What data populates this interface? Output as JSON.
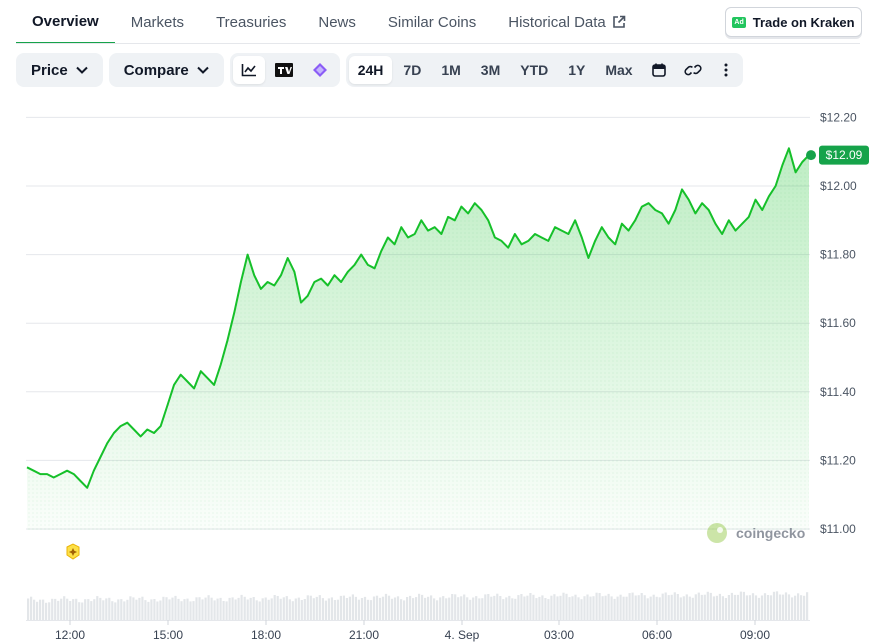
{
  "tabs": [
    {
      "label": "Overview",
      "active": true
    },
    {
      "label": "Markets"
    },
    {
      "label": "Treasuries"
    },
    {
      "label": "News"
    },
    {
      "label": "Similar Coins"
    },
    {
      "label": "Historical Data"
    }
  ],
  "trade_button": {
    "ad": "Ad",
    "label": "Trade on Kraken"
  },
  "toolbar": {
    "price": "Price",
    "compare": "Compare",
    "ranges": [
      "24H",
      "7D",
      "1M",
      "3M",
      "YTD",
      "1Y",
      "Max"
    ],
    "active_range": "24H"
  },
  "icons": [
    "line-chart-icon",
    "tradingview-icon",
    "diamond-icon",
    "calendar-icon",
    "link-icon",
    "more-icon",
    "chevron-down-icon",
    "external-link-icon"
  ],
  "colors": {
    "line": "#16c02a",
    "accent": "#16a34a",
    "label_bg": "#16a34a",
    "badge": "#fde047"
  },
  "watermark": "coingecko",
  "chart_data": {
    "type": "area",
    "ylim": [
      10.95,
      12.22
    ],
    "yticks": [
      11.0,
      11.2,
      11.4,
      11.6,
      11.8,
      12.0,
      12.2
    ],
    "ytick_labels": [
      "$11.00",
      "$11.20",
      "$11.40",
      "$11.60",
      "$11.80",
      "$12.00",
      "$12.20"
    ],
    "xtick_labels": [
      "12:00",
      "15:00",
      "18:00",
      "21:00",
      "4. Sep",
      "03:00",
      "06:00",
      "09:00"
    ],
    "current_price": 12.09,
    "current_label": "$12.09",
    "grid": true,
    "series": [
      {
        "values": [
          11.18,
          11.17,
          11.16,
          11.16,
          11.15,
          11.16,
          11.17,
          11.16,
          11.14,
          11.12,
          11.17,
          11.21,
          11.25,
          11.28,
          11.3,
          11.31,
          11.29,
          11.27,
          11.29,
          11.28,
          11.3,
          11.36,
          11.42,
          11.45,
          11.43,
          11.41,
          11.46,
          11.44,
          11.42,
          11.48,
          11.55,
          11.63,
          11.72,
          11.8,
          11.74,
          11.7,
          11.72,
          11.71,
          11.74,
          11.79,
          11.75,
          11.66,
          11.68,
          11.72,
          11.73,
          11.71,
          11.74,
          11.72,
          11.75,
          11.77,
          11.8,
          11.77,
          11.76,
          11.81,
          11.85,
          11.83,
          11.88,
          11.85,
          11.86,
          11.9,
          11.87,
          11.88,
          11.86,
          11.91,
          11.9,
          11.94,
          11.92,
          11.95,
          11.93,
          11.9,
          11.85,
          11.84,
          11.82,
          11.86,
          11.83,
          11.84,
          11.86,
          11.85,
          11.84,
          11.88,
          11.87,
          11.86,
          11.9,
          11.85,
          11.79,
          11.84,
          11.88,
          11.85,
          11.83,
          11.89,
          11.87,
          11.9,
          11.94,
          11.95,
          11.93,
          11.92,
          11.89,
          11.93,
          11.99,
          11.96,
          11.92,
          11.95,
          11.93,
          11.89,
          11.86,
          11.9,
          11.87,
          11.89,
          11.91,
          11.96,
          11.93,
          11.97,
          12.0,
          12.06,
          12.11,
          12.04,
          12.07,
          12.09
        ]
      }
    ]
  }
}
